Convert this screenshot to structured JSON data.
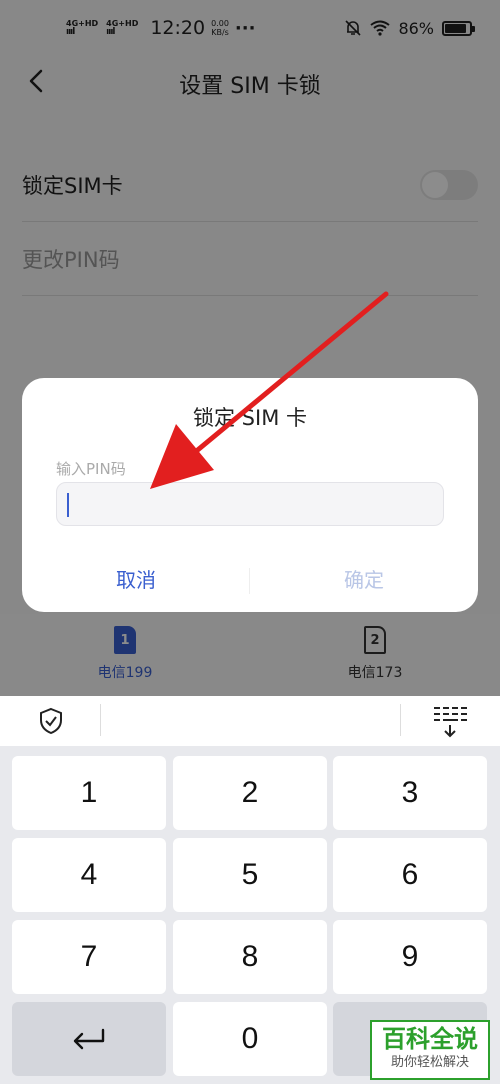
{
  "status_bar": {
    "net1": "4G+HD",
    "net2": "4G+HD",
    "time": "12:20",
    "speed_value": "0.00",
    "speed_unit": "KB/s",
    "dots": "···",
    "battery": "86%"
  },
  "header": {
    "title": "设置 SIM 卡锁"
  },
  "settings": {
    "lock_label": "锁定SIM卡",
    "lock_enabled": false,
    "change_pin_label": "更改PIN码"
  },
  "sim_tabs": [
    {
      "number": "1",
      "label": "电信199",
      "selected": true
    },
    {
      "number": "2",
      "label": "电信173",
      "selected": false
    }
  ],
  "dialog": {
    "title": "锁定 SIM 卡",
    "input_label": "输入PIN码",
    "input_value": "",
    "cancel_label": "取消",
    "confirm_label": "确定"
  },
  "keyboard": {
    "keys": [
      "1",
      "2",
      "3",
      "4",
      "5",
      "6",
      "7",
      "8",
      "9",
      "0"
    ]
  },
  "watermark": {
    "title": "百科全说",
    "subtitle": "助你轻松解决"
  },
  "colors": {
    "accent": "#3a5fcf",
    "arrow": "#e21f1f",
    "watermark": "#2ca02c"
  }
}
